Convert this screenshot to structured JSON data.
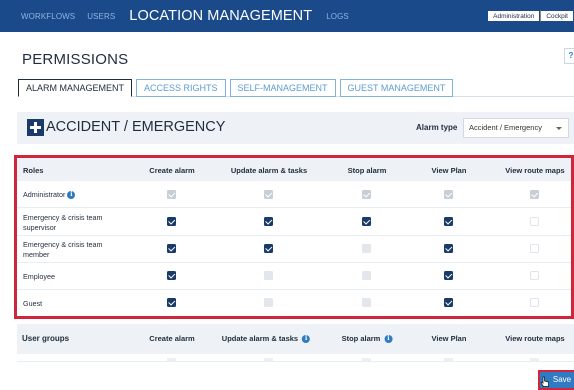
{
  "topnav": {
    "items": [
      {
        "label": "WORKFLOWS"
      },
      {
        "label": "USERS"
      },
      {
        "label": "LOCATION MANAGEMENT"
      },
      {
        "label": "LOGS"
      }
    ],
    "active_index": 2,
    "right_buttons": [
      {
        "label": "Administration"
      },
      {
        "label": "Cockpit"
      }
    ]
  },
  "page": {
    "title": "PERMISSIONS",
    "help_label": "?"
  },
  "tabs": [
    {
      "label": "ALARM MANAGEMENT",
      "active": true
    },
    {
      "label": "ACCESS RIGHTS",
      "active": false
    },
    {
      "label": "SELF-MANAGEMENT",
      "active": false
    },
    {
      "label": "GUEST MANAGEMENT",
      "active": false
    }
  ],
  "section": {
    "title": "ACCIDENT / EMERGENCY",
    "icon": "plus-cross-icon",
    "alarm_type_label": "Alarm type",
    "alarm_type_value": "Accident / Emergency"
  },
  "roles_table": {
    "headers": [
      "Roles",
      "Create alarm",
      "Update alarm & tasks",
      "Stop alarm",
      "View Plan",
      "View route maps"
    ],
    "rows": [
      {
        "label": "Administrator",
        "has_info": true,
        "cells": [
          "checked-disabled",
          "checked-disabled",
          "checked-disabled",
          "checked-disabled",
          "checked-disabled"
        ]
      },
      {
        "label": "Emergency & crisis team supervisor",
        "has_info": false,
        "cells": [
          "checked",
          "checked",
          "checked",
          "checked",
          "unchecked-empty"
        ]
      },
      {
        "label": "Emergency & crisis team member",
        "has_info": false,
        "cells": [
          "checked",
          "checked",
          "unchecked-disabled",
          "checked",
          "unchecked-empty"
        ]
      },
      {
        "label": "Employee",
        "has_info": false,
        "cells": [
          "checked",
          "unchecked-disabled",
          "unchecked-disabled",
          "checked",
          "unchecked-empty"
        ]
      },
      {
        "label": "Guest",
        "has_info": false,
        "cells": [
          "checked",
          "unchecked-disabled",
          "unchecked-disabled",
          "checked",
          "unchecked-empty"
        ]
      }
    ]
  },
  "user_groups_table": {
    "headers": [
      "User groups",
      "Create alarm",
      "Update alarm & tasks",
      "Stop alarm",
      "View Plan",
      "View route maps"
    ],
    "info_on": [
      2,
      3
    ]
  },
  "save_button": {
    "label": "Save"
  },
  "colors": {
    "navbar": "#1a4a8a",
    "accent": "#2f7ac2",
    "highlight": "#d0263c",
    "checkbox_on": "#1a3a6a"
  }
}
